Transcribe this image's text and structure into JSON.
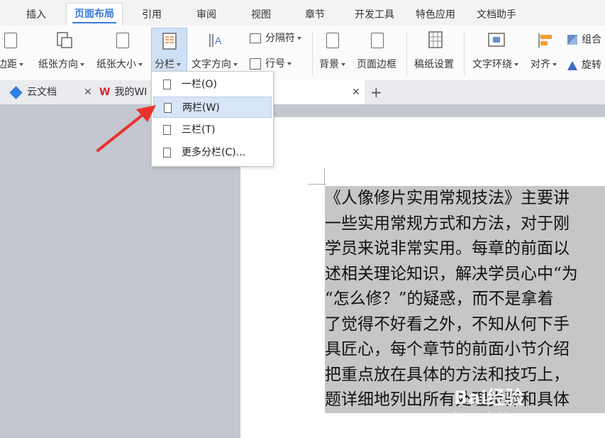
{
  "ribbon_tabs": [
    "插入",
    "页面布局",
    "引用",
    "审阅",
    "视图",
    "章节",
    "开发工具",
    "特色应用",
    "文档助手"
  ],
  "active_tab": "页面布局",
  "ribbon": {
    "margin": "页边距",
    "orientation": "纸张方向",
    "size": "纸张大小",
    "columns": "分栏",
    "text_direction": "文字方向",
    "separator": "分隔符",
    "line_number": "行号",
    "background": "背景",
    "page_border": "页面边框",
    "manuscript": "稿纸设置",
    "text_wrap": "文字环绕",
    "align": "对齐",
    "group": "组合",
    "rotate": "旋转"
  },
  "doc_tabs": {
    "cloud": "云文档",
    "doc": "我的WI",
    "add": "+"
  },
  "columns_menu": {
    "items": [
      "一栏(O)",
      "两栏(W)",
      "三栏(T)",
      "更多分栏(C)..."
    ],
    "highlighted": "两栏(W)"
  },
  "document_lines": [
    "《人像修片实用常规技法》主要讲",
    "一些实用常规方式和方法，对于刚",
    "学员来说非常实用。每章的前面以",
    "述相关理论知识，解决学员心中“为",
    "“怎么修？”的疑惑，而不是拿着",
    "了觉得不好看之外，不知从何下手",
    "具匠心，每个章节的前面小节介绍",
    "把重点放在具体的方法和技巧上，",
    "题详细地列出所有处理步骤和具体"
  ],
  "watermark": {
    "brand": "Bai经验",
    "url": "jingyan.baidu.com"
  },
  "colors": {
    "accent": "#3779d9",
    "highlight": "#c6c6c6",
    "arrow": "#e8322e"
  }
}
